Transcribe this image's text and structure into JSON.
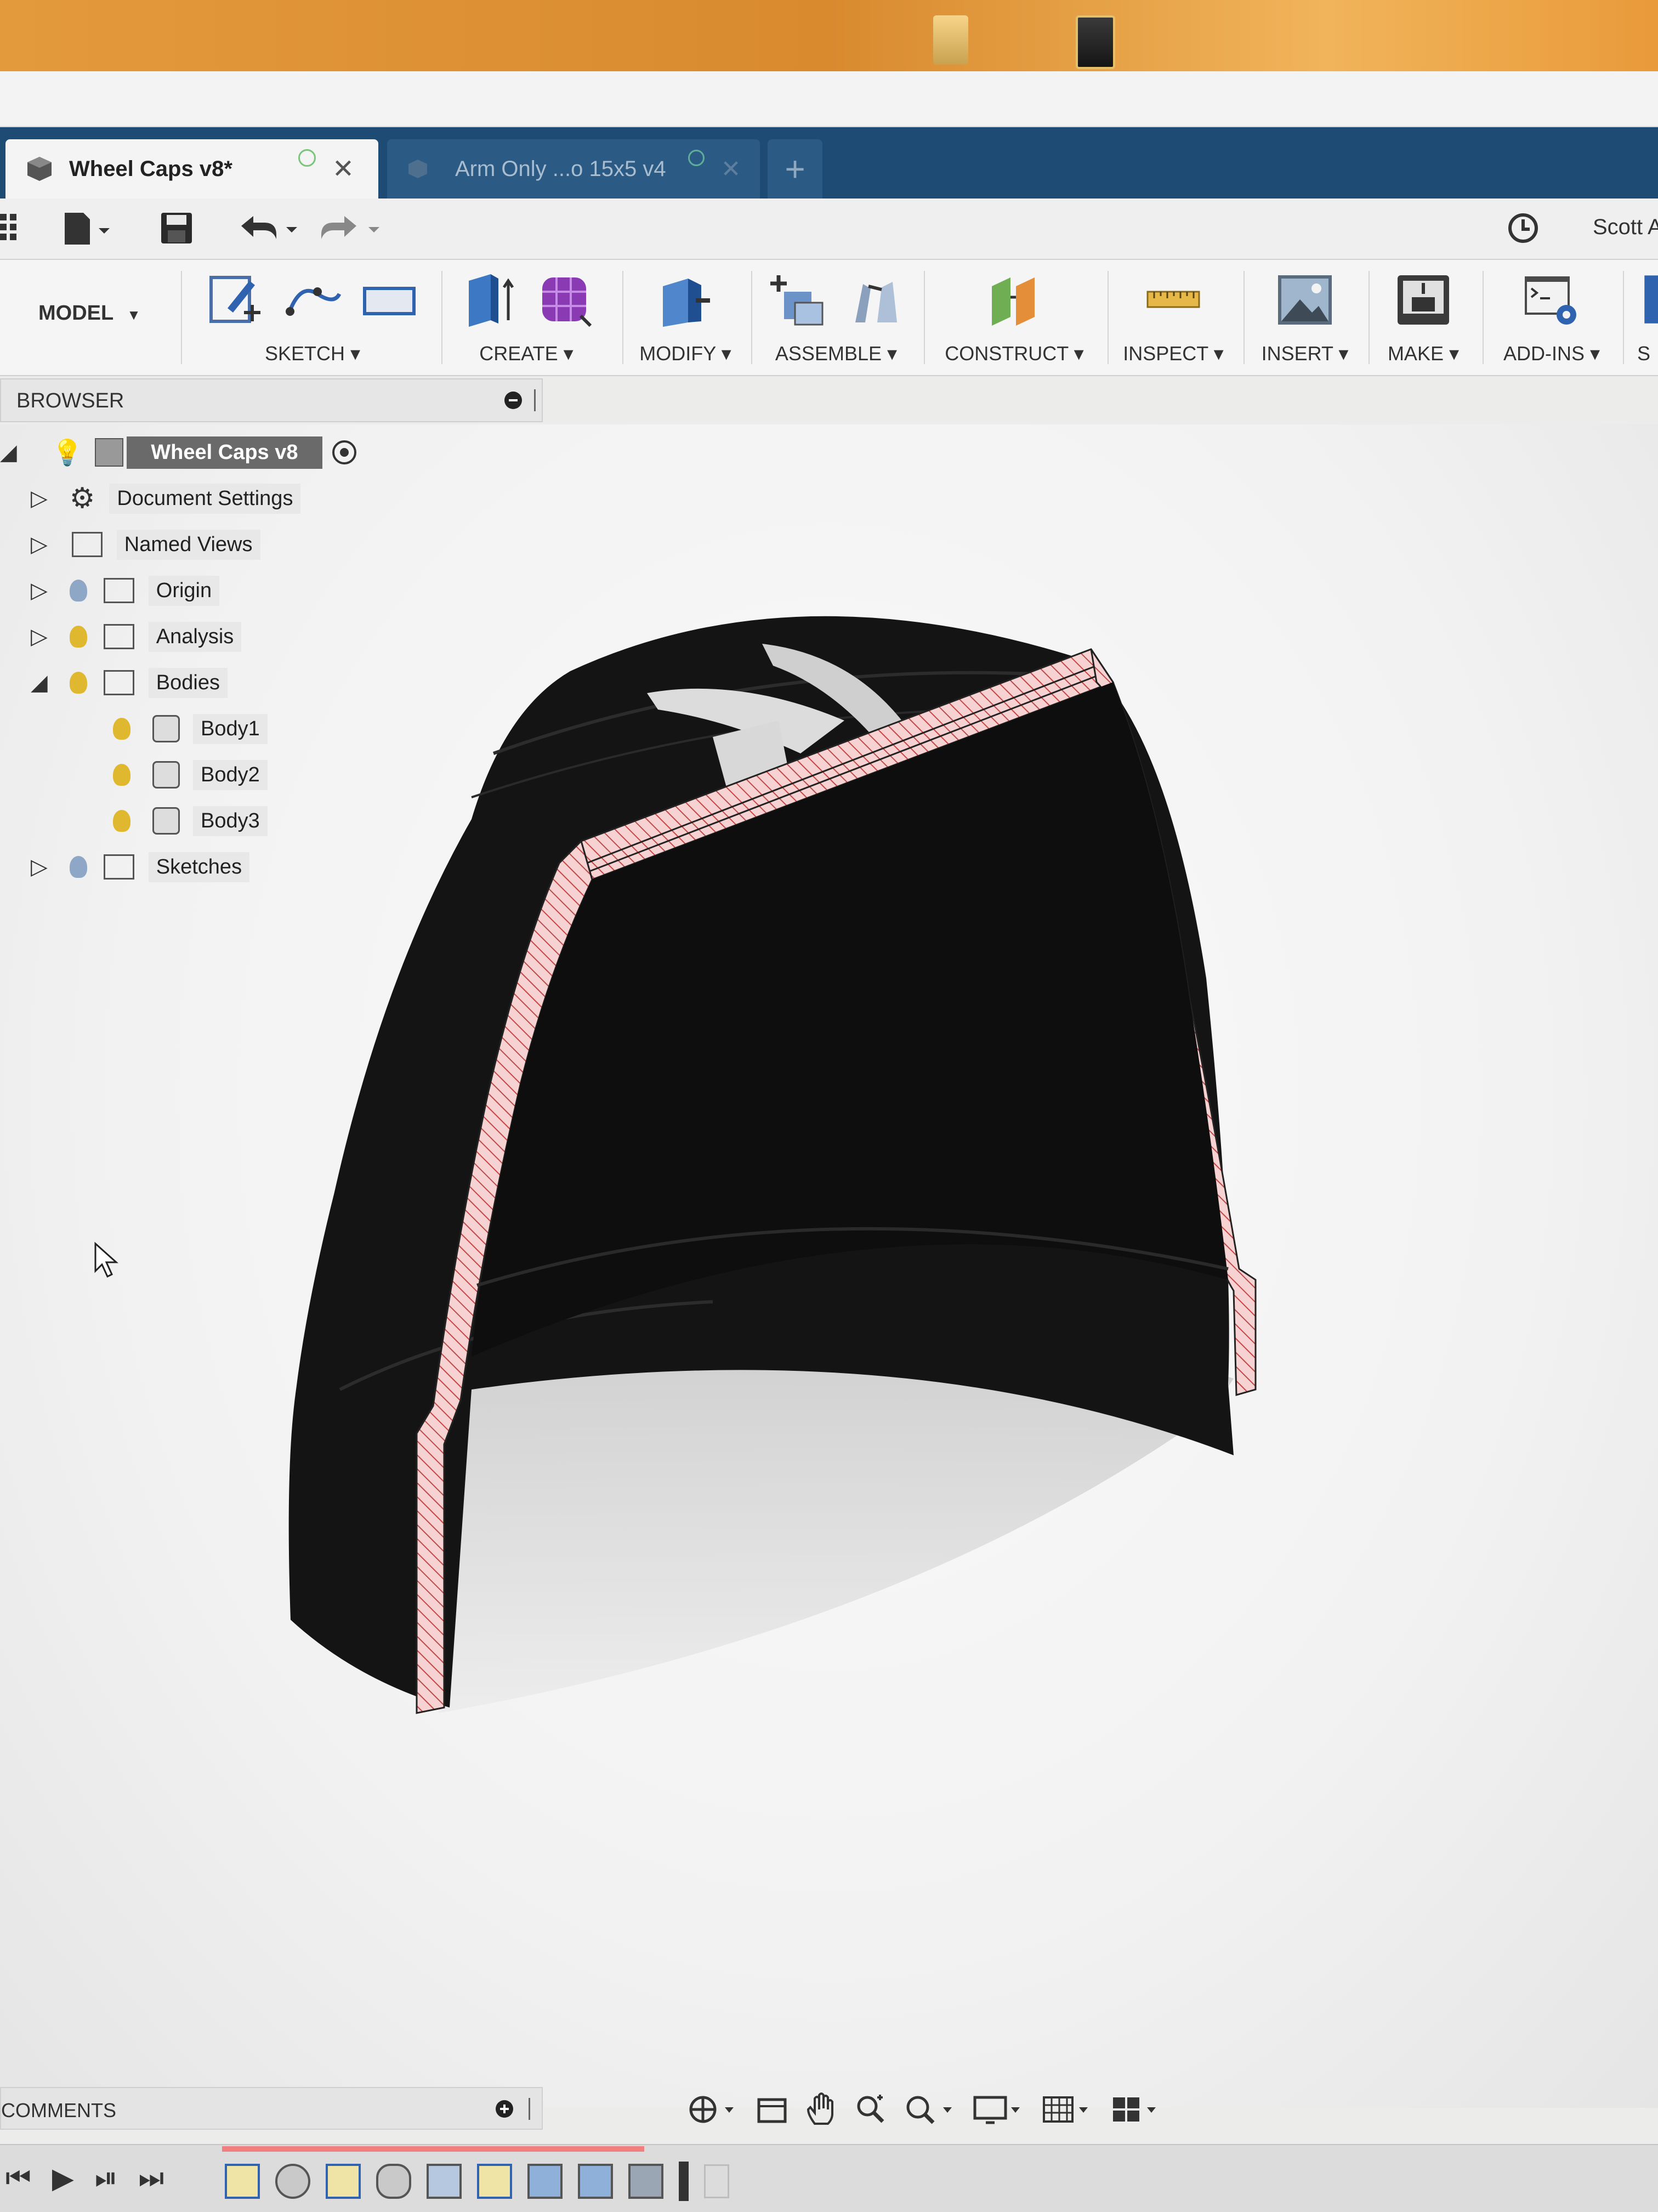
{
  "window": {
    "user_name": "Scott A"
  },
  "tabs": [
    {
      "label": "Wheel Caps v8*",
      "active": true
    },
    {
      "label": "Arm Only ...o 15x5 v4",
      "active": false
    }
  ],
  "workspace": {
    "label": "MODEL"
  },
  "ribbon": {
    "groups": [
      {
        "label": "SKETCH"
      },
      {
        "label": "CREATE"
      },
      {
        "label": "MODIFY"
      },
      {
        "label": "ASSEMBLE"
      },
      {
        "label": "CONSTRUCT"
      },
      {
        "label": "INSPECT"
      },
      {
        "label": "INSERT"
      },
      {
        "label": "MAKE"
      },
      {
        "label": "ADD-INS"
      },
      {
        "label": "S"
      }
    ]
  },
  "browser": {
    "title": "BROWSER",
    "root": {
      "label": "Wheel Caps v8"
    },
    "items": [
      {
        "label": "Document Settings"
      },
      {
        "label": "Named Views"
      },
      {
        "label": "Origin"
      },
      {
        "label": "Analysis"
      },
      {
        "label": "Bodies"
      },
      {
        "label": "Body1"
      },
      {
        "label": "Body2"
      },
      {
        "label": "Body3"
      },
      {
        "label": "Sketches"
      }
    ]
  },
  "comments": {
    "title": "COMMENTS"
  },
  "colors": {
    "tab_bar": "#1e4b73",
    "section_fill": "#f4c9c9",
    "section_hatch": "#c04040",
    "model_body": "#141414"
  }
}
